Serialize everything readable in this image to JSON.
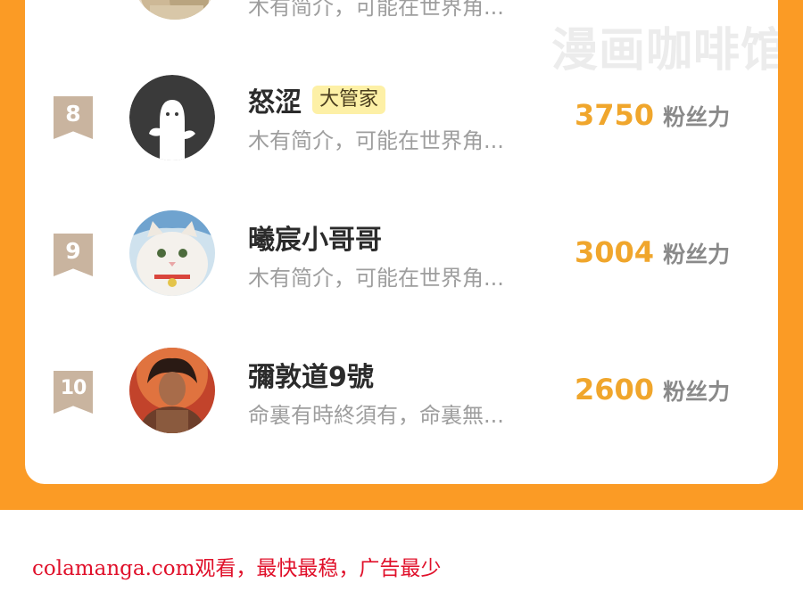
{
  "colors": {
    "frame_orange": "#fb9b25",
    "score_gold": "#f0a62c",
    "rank_badge": "#c9b49f",
    "role_badge_bg": "#fdf0a6",
    "footer_red": "#e0102a"
  },
  "watermark": "漫画咖啡馆",
  "top_row": {
    "bio": "木有简介，可能在世界角..."
  },
  "ranking": [
    {
      "rank": "8",
      "name": "怒涩",
      "role": "大管家",
      "bio": "木有简介，可能在世界角...",
      "score": "3750",
      "unit": "粉丝力",
      "avatar": "ghost-avatar"
    },
    {
      "rank": "9",
      "name": "曦宸小哥哥",
      "role": "",
      "bio": "木有简介，可能在世界角...",
      "score": "3004",
      "unit": "粉丝力",
      "avatar": "cat-avatar"
    },
    {
      "rank": "10",
      "name": "彌敦道9號",
      "role": "",
      "bio": "命裏有時終須有，命裏無...",
      "score": "2600",
      "unit": "粉丝力",
      "avatar": "person-avatar"
    }
  ],
  "footer": {
    "text": "colamanga.com观看，最快最稳，广告最少"
  }
}
